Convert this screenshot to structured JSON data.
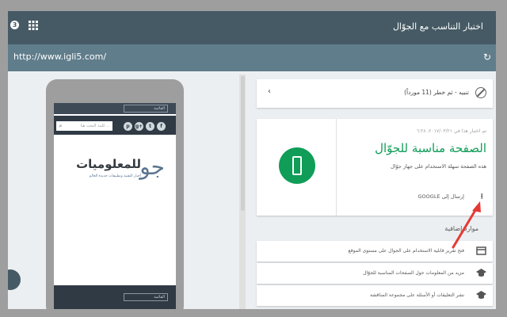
{
  "header": {
    "title": "اختبار التناسب مع الجوّال",
    "badge_count": "3",
    "apps_icon": "apps-icon"
  },
  "url_bar": {
    "url": "http://www.igli5.com/",
    "refresh_icon": "refresh-icon"
  },
  "preview": {
    "menu_label": "القائمة",
    "search_placeholder": "كلمة البحث هنا ...",
    "social_icons": [
      "f",
      "t",
      "g+",
      "p"
    ],
    "logo_text": "للمعلوميات",
    "logo_subtitle": "أخبار التقنية وتطبيقات جديدة العالم",
    "logo_mark": "جو",
    "bottom_menu_label": "القائمة"
  },
  "warning": {
    "text": "تنبيه - ثم خطر (11 مورداً)",
    "icon": "blocked-icon",
    "chevron": "chevron-left-icon"
  },
  "result": {
    "date": "تم اختبار هذا في ٢٠١٧/٠٣/٢١، ٦:٢٨",
    "headline": "الصفحة مناسبة للجوّال",
    "description": "هذه الصفحة سهلة الاستخدام على جهاز جوّال",
    "send_label": "إرسال إلى GOOGLE",
    "badge_color": "#0f9d58"
  },
  "resources": {
    "title": "موارد إضافية",
    "items": [
      {
        "label": "فتح تقرير قابلية الاستخدام على الجوال على مستوى الموقع",
        "icon": "report-icon"
      },
      {
        "label": "مزيد من المعلومات حول الصفحات المناسبة للجوّال",
        "icon": "school-icon"
      },
      {
        "label": "نشر التعليقات أو الأسئلة على مجموعة المناقشة",
        "icon": "school-icon"
      }
    ]
  },
  "colors": {
    "header": "#455a64",
    "url_bar": "#607d8b",
    "accent": "#0f9d58",
    "annotation_arrow": "#e53935"
  }
}
